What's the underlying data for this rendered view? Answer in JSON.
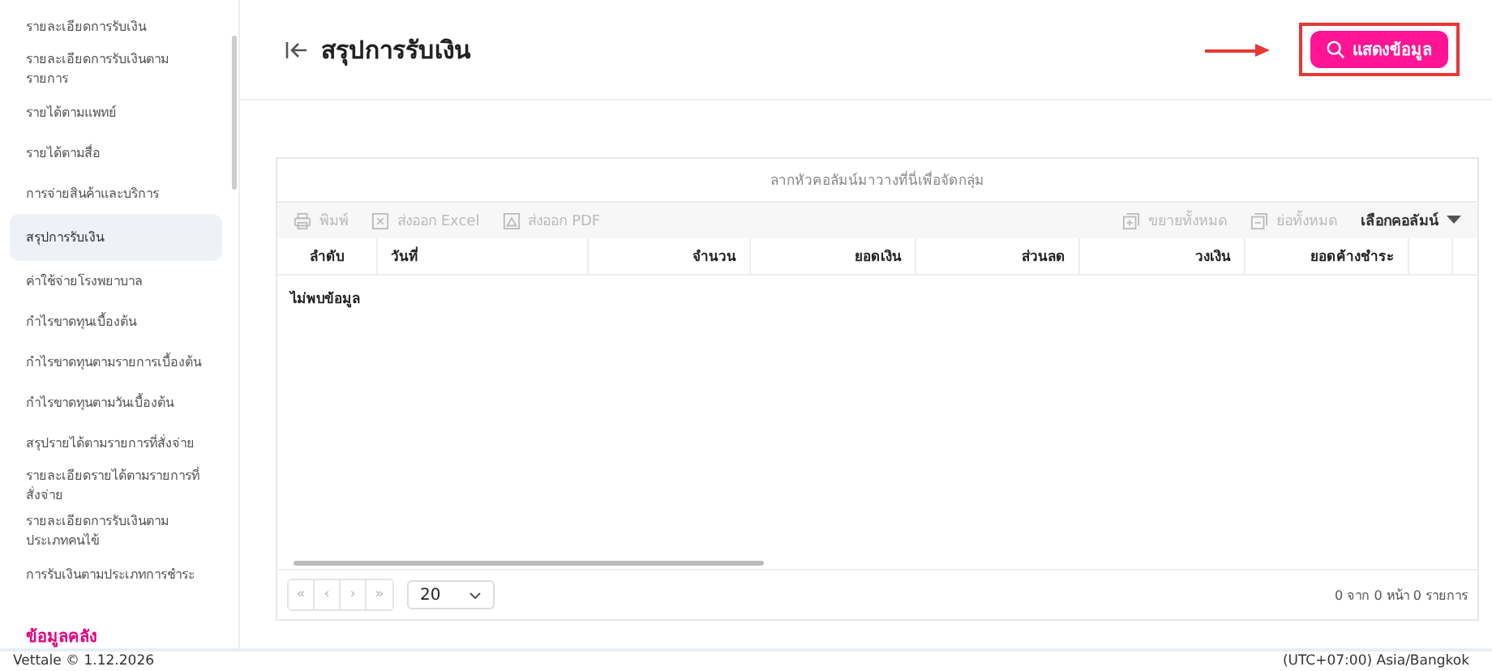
{
  "sidebar": {
    "items": [
      {
        "label": "รายละเอียดการรับเงิน",
        "selected": false
      },
      {
        "label": "รายละเอียดการรับเงินตามรายการ",
        "selected": false
      },
      {
        "label": "รายได้ตามแพทย์",
        "selected": false
      },
      {
        "label": "รายได้ตามสื่อ",
        "selected": false
      },
      {
        "label": "การจ่ายสินค้าและบริการ",
        "selected": false
      },
      {
        "label": "สรุปการรับเงิน",
        "selected": true
      },
      {
        "label": "ค่าใช้จ่ายโรงพยาบาล",
        "selected": false
      },
      {
        "label": "กำไรขาดทุนเบื้องต้น",
        "selected": false
      },
      {
        "label": "กำไรขาดทุนตามรายการเบื้องต้น",
        "selected": false
      },
      {
        "label": "กำไรขาดทุนตามวันเบื้องต้น",
        "selected": false
      },
      {
        "label": "สรุปรายได้ตามรายการที่สั่งจ่าย",
        "selected": false
      },
      {
        "label": "รายละเอียดรายได้ตามรายการที่สั่งจ่าย",
        "selected": false
      },
      {
        "label": "รายละเอียดการรับเงินตามประเภทคนไข้",
        "selected": false
      },
      {
        "label": "การรับเงินตามประเภทการชำระ",
        "selected": false
      }
    ],
    "section_title": "ข้อมูลคลัง"
  },
  "header": {
    "title": "สรุปการรับเงิน",
    "button": "แสดงข้อมูล"
  },
  "grid": {
    "group_hint": "ลากหัวคอลัมน์มาวางที่นี่เพื่อจัดกลุ่ม",
    "toolbar": [
      {
        "kind": "print",
        "label": "พิมพ์",
        "disabled": true
      },
      {
        "kind": "excel",
        "label": "ส่งออก Excel",
        "disabled": true
      },
      {
        "kind": "pdf",
        "label": "ส่งออก PDF",
        "disabled": true
      },
      {
        "kind": "expand",
        "label": "ขยายทั้งหมด",
        "disabled": true
      },
      {
        "kind": "collapse",
        "label": "ย่อทั้งหมด",
        "disabled": true
      },
      {
        "kind": "columns",
        "label": "เลือกคอลัมน์",
        "disabled": false
      }
    ],
    "columns": [
      "ลำดับ",
      "วันที่",
      "จำนวน",
      "ยอดเงิน",
      "ส่วนลด",
      "วงเงิน",
      "ยอดค้างชำระ"
    ],
    "empty_text": "ไม่พบข้อมูล",
    "pager": {
      "buttons": [
        {
          "label": "«",
          "disabled": true
        },
        {
          "label": "‹",
          "disabled": true
        },
        {
          "label": "›",
          "disabled": true
        },
        {
          "label": "»",
          "disabled": true
        }
      ],
      "page_size": "20",
      "info": "0 จาก 0 หน้า 0 รายการ"
    }
  },
  "footer": {
    "left": "Vettale © 1.12.2026",
    "right": "(UTC+07:00) Asia/Bangkok"
  }
}
